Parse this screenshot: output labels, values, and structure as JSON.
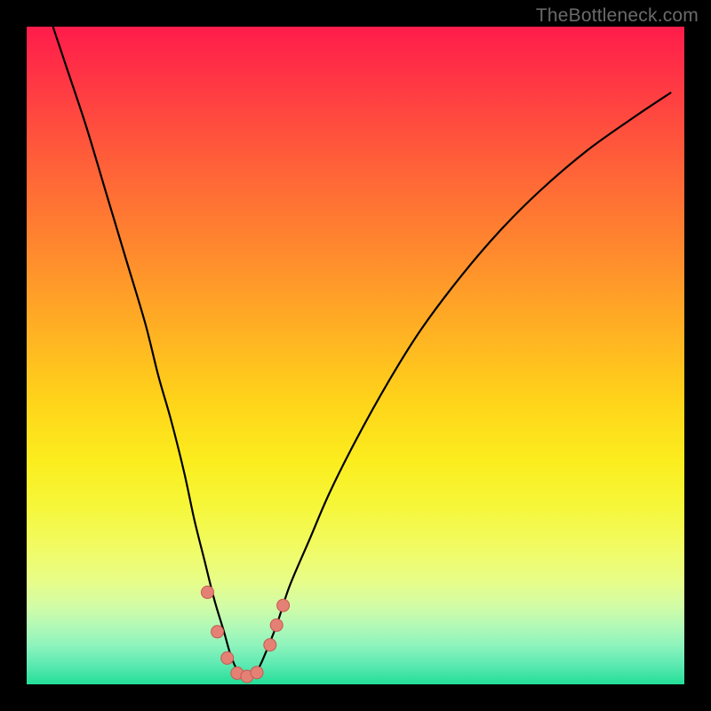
{
  "watermark": "TheBottleneck.com",
  "colors": {
    "bg": "#000000",
    "curve": "#000000",
    "marker_fill": "#e58075",
    "marker_stroke": "#c45a52"
  },
  "chart_data": {
    "type": "line",
    "title": "",
    "xlabel": "",
    "ylabel": "",
    "xlim": [
      0,
      100
    ],
    "ylim": [
      0,
      100
    ],
    "grid": false,
    "series": [
      {
        "name": "bottleneck-curve",
        "x": [
          4,
          6,
          9,
          12,
          15,
          18,
          20,
          22,
          24,
          25.5,
          27,
          28.5,
          30,
          31,
          32,
          33,
          34,
          35,
          36,
          38,
          40,
          43,
          46,
          50,
          55,
          60,
          66,
          72,
          78,
          85,
          92,
          98
        ],
        "y": [
          100,
          94,
          85,
          75,
          65,
          55,
          47,
          40,
          32,
          25,
          19,
          13,
          8,
          4.5,
          2.2,
          1.2,
          1.2,
          2.0,
          4.0,
          9,
          15,
          22,
          29,
          37,
          46,
          54,
          62,
          69,
          75,
          81,
          86,
          90
        ]
      }
    ],
    "markers": [
      {
        "x": 27.5,
        "y": 14
      },
      {
        "x": 29.0,
        "y": 8
      },
      {
        "x": 30.5,
        "y": 4
      },
      {
        "x": 32.0,
        "y": 1.7
      },
      {
        "x": 33.5,
        "y": 1.2
      },
      {
        "x": 35.0,
        "y": 1.8
      },
      {
        "x": 37.0,
        "y": 6
      },
      {
        "x": 38.0,
        "y": 9
      },
      {
        "x": 39.0,
        "y": 12
      }
    ],
    "annotations": []
  }
}
